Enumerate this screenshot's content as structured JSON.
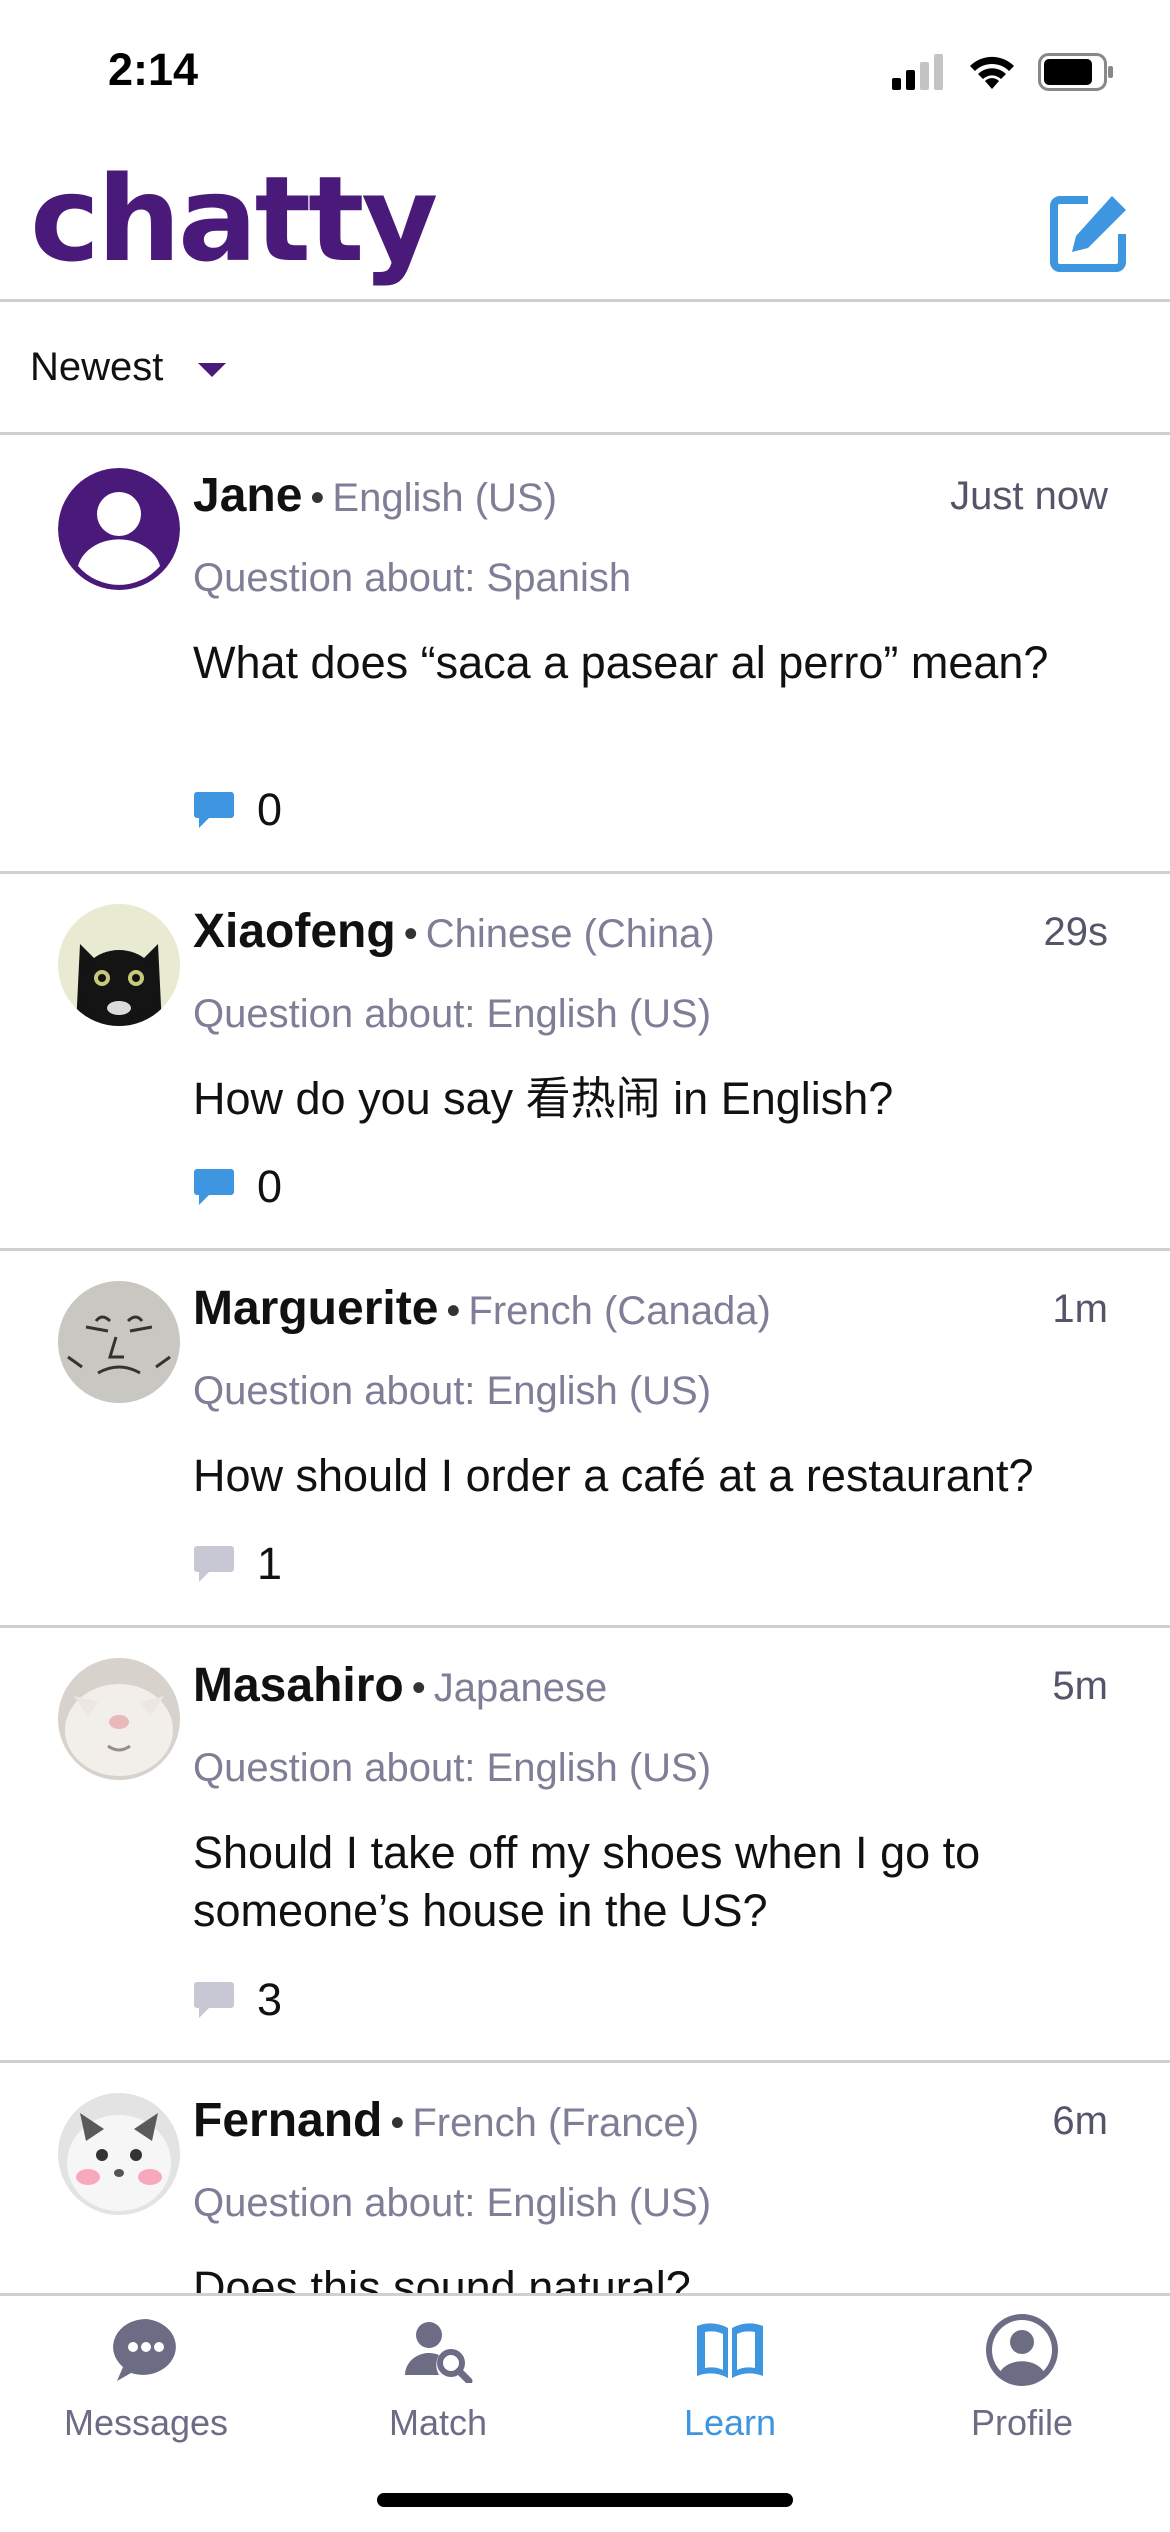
{
  "status_bar": {
    "time": "2:14"
  },
  "header": {
    "logo": "chatty",
    "compose_icon": "compose-icon"
  },
  "sort": {
    "label": "Newest"
  },
  "colors": {
    "brand": "#4a1a7a",
    "accent": "#3e95e0",
    "muted": "#7e7e97",
    "reply_active": "#3e95e0",
    "reply_inactive": "#c8c8d4"
  },
  "posts": [
    {
      "name": "Jane",
      "language": "English (US)",
      "time": "Just now",
      "about": "Question about: Spanish",
      "body": "What does “saca a pasear al perro” mean?",
      "replies": "0",
      "reply_active": true
    },
    {
      "name": "Xiaofeng",
      "language": "Chinese (China)",
      "time": "29s",
      "about": "Question about: English (US)",
      "body": "How do you say 看热闹 in English?",
      "replies": "0",
      "reply_active": true
    },
    {
      "name": "Marguerite",
      "language": "French (Canada)",
      "time": "1m",
      "about": "Question about: English (US)",
      "body": "How should I order a café at a restaurant?",
      "replies": "1",
      "reply_active": false
    },
    {
      "name": "Masahiro",
      "language": "Japanese",
      "time": "5m",
      "about": "Question about: English (US)",
      "body": "Should I take off my shoes when I go to someone’s house in the US?",
      "replies": "3",
      "reply_active": false
    },
    {
      "name": "Fernand",
      "language": "French (France)",
      "time": "6m",
      "about": "Question about: English (US)",
      "body": "Does this sound natural?",
      "replies": "",
      "reply_active": false
    }
  ],
  "tabs": [
    {
      "label": "Messages",
      "icon": "messages-icon"
    },
    {
      "label": "Match",
      "icon": "match-icon"
    },
    {
      "label": "Learn",
      "icon": "learn-icon",
      "active": true
    },
    {
      "label": "Profile",
      "icon": "profile-icon"
    }
  ]
}
